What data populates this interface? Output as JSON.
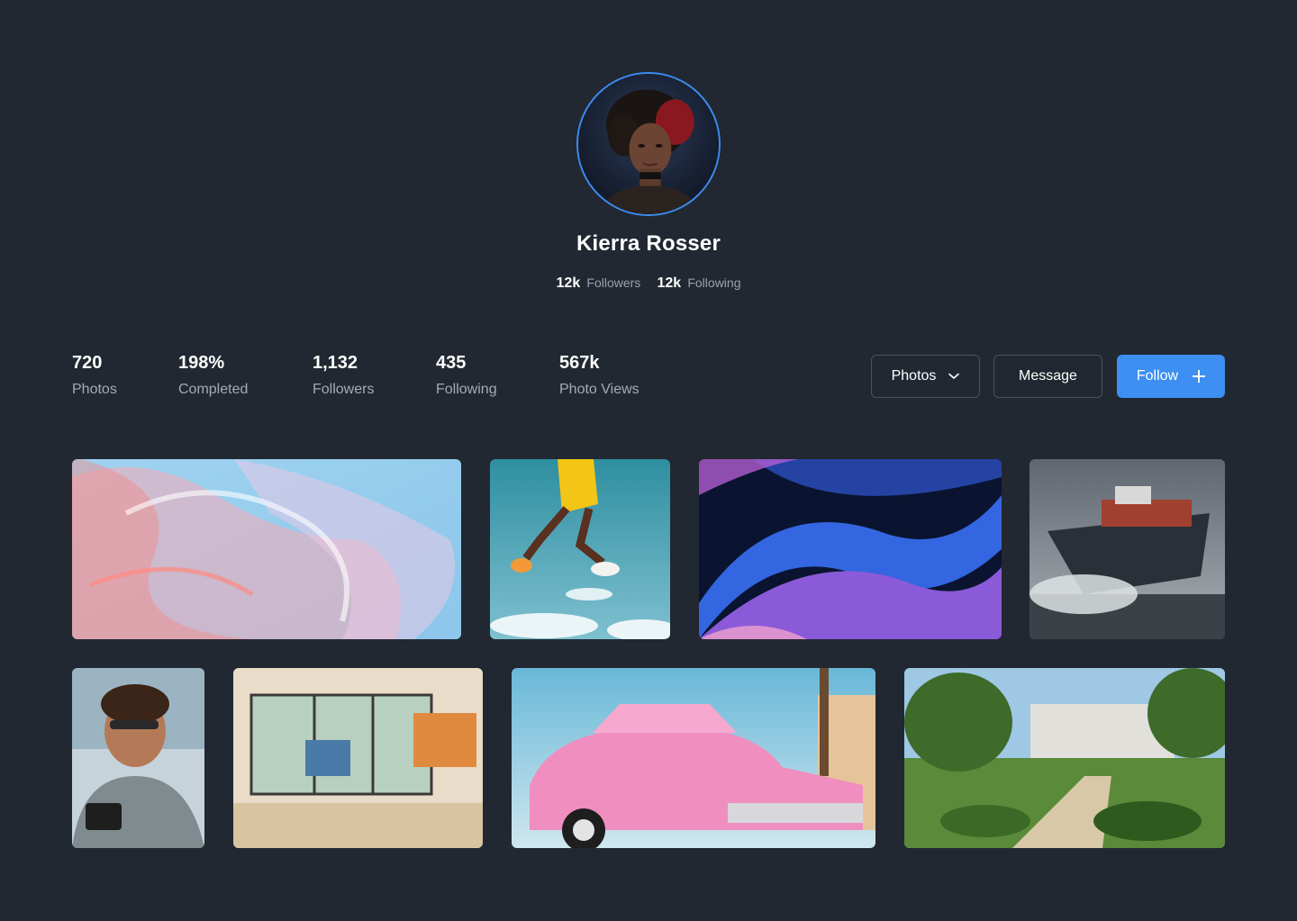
{
  "profile": {
    "name": "Kierra Rosser",
    "followers_count": "12k",
    "followers_label": "Followers",
    "following_count": "12k",
    "following_label": "Following"
  },
  "stats": [
    {
      "value": "720",
      "label": "Photos"
    },
    {
      "value": "198%",
      "label": "Completed"
    },
    {
      "value": "1,132",
      "label": "Followers"
    },
    {
      "value": "435",
      "label": "Following"
    },
    {
      "value": "567k",
      "label": "Photo Views"
    }
  ],
  "actions": {
    "filter_label": "Photos",
    "message_label": "Message",
    "follow_label": "Follow"
  },
  "colors": {
    "background": "#222831",
    "accent": "#3d8ff2",
    "muted_text": "#a3abb6"
  },
  "icons": {
    "filter_chevron": "chevron-down-icon",
    "follow_plus": "plus-icon"
  }
}
